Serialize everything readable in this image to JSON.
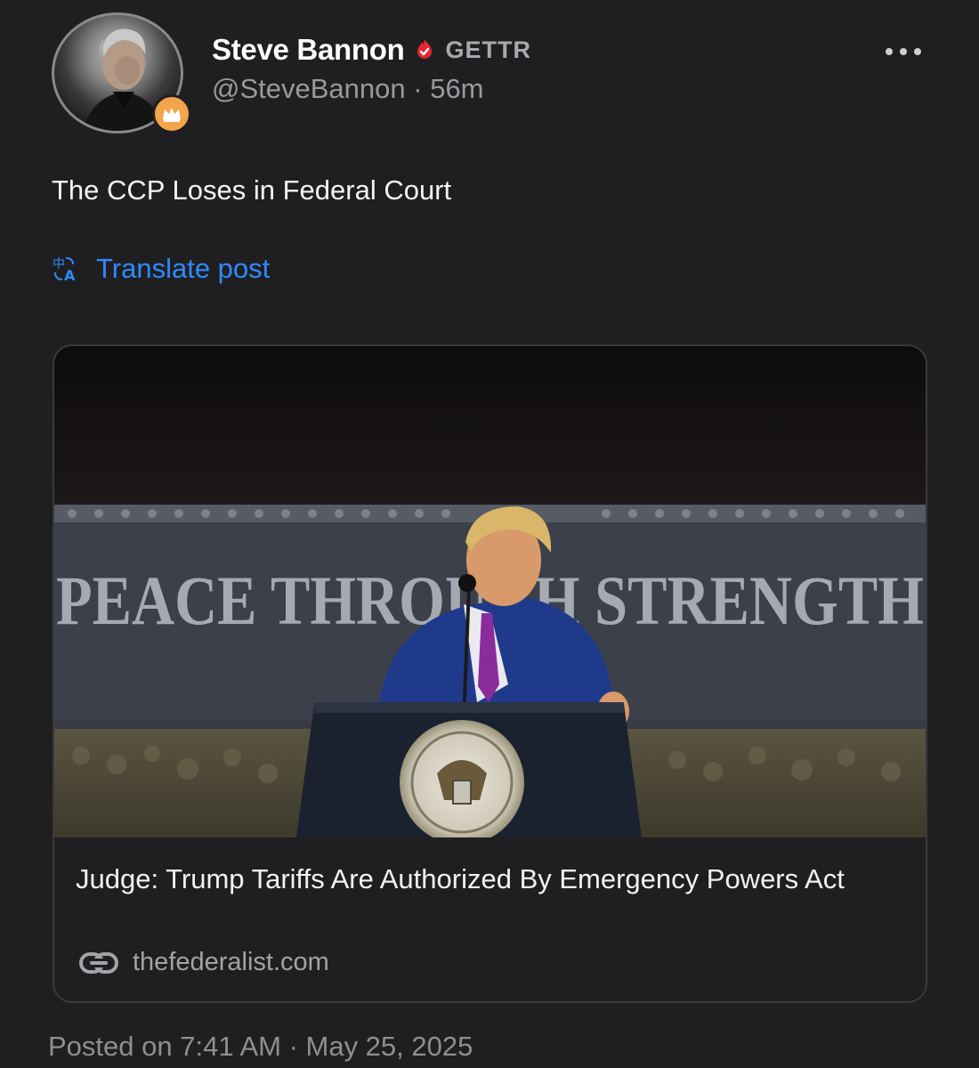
{
  "author": {
    "name": "Steve Bannon",
    "platform_label": "GETTR",
    "handle": "@SteveBannon",
    "time_ago": "56m",
    "meta_separator": "·"
  },
  "post": {
    "text": "The CCP Loses in Federal Court",
    "translate_label": "Translate post"
  },
  "link_card": {
    "title": "Judge: Trump Tariffs Are Authorized By Emergency Powers Act",
    "domain": "thefederalist.com",
    "image_banner_text": "PEACE THROUGH STRENGTH"
  },
  "footer": {
    "posted_on": "Posted on 7:41 AM · May 25, 2025"
  },
  "colors": {
    "background": "#1f1f21",
    "accent_blue": "#2e8bff",
    "verified_red": "#e8262f",
    "badge_orange": "#f2a54a"
  }
}
